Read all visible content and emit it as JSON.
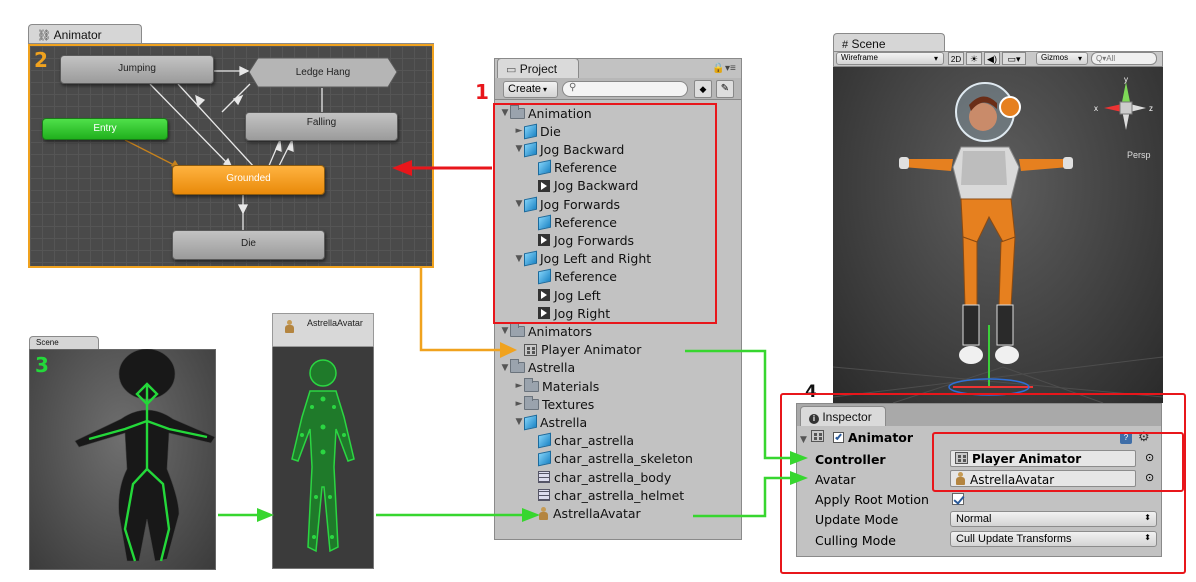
{
  "colors": {
    "highlight_red": "#e8161b",
    "arrow_orange": "#f0a21e",
    "arrow_green": "#37d62f",
    "state_orange": "#f39c1a",
    "entry_green": "#33c92f",
    "skeleton_green": "#24d83a"
  },
  "badges": {
    "b1": "1",
    "b2": "2",
    "b3": "3",
    "b4": "4"
  },
  "animator": {
    "tab_label": "Animator",
    "tab_icon": "animator-icon",
    "states": {
      "jumping": "Jumping",
      "ledge_hang": "Ledge Hang",
      "entry": "Entry",
      "falling": "Falling",
      "grounded": "Grounded",
      "die": "Die"
    }
  },
  "project": {
    "tab_label": "Project",
    "create_label": "Create",
    "search_placeholder": "",
    "tree": [
      {
        "label": "Animation",
        "icon": "folder-icon",
        "depth": 0,
        "arrow": "▼"
      },
      {
        "label": "Die",
        "icon": "model-icon",
        "depth": 1,
        "arrow": "►"
      },
      {
        "label": "Jog Backward",
        "icon": "model-icon",
        "depth": 1,
        "arrow": "▼"
      },
      {
        "label": "Reference",
        "icon": "model-icon",
        "depth": 2,
        "arrow": ""
      },
      {
        "label": "Jog Backward",
        "icon": "clip-icon",
        "depth": 2,
        "arrow": ""
      },
      {
        "label": "Jog Forwards",
        "icon": "model-icon",
        "depth": 1,
        "arrow": "▼"
      },
      {
        "label": "Reference",
        "icon": "model-icon",
        "depth": 2,
        "arrow": ""
      },
      {
        "label": "Jog Forwards",
        "icon": "clip-icon",
        "depth": 2,
        "arrow": ""
      },
      {
        "label": "Jog Left and Right",
        "icon": "model-icon",
        "depth": 1,
        "arrow": "▼"
      },
      {
        "label": "Reference",
        "icon": "model-icon",
        "depth": 2,
        "arrow": ""
      },
      {
        "label": "Jog Left",
        "icon": "clip-icon",
        "depth": 2,
        "arrow": ""
      },
      {
        "label": "Jog Right",
        "icon": "clip-icon",
        "depth": 2,
        "arrow": ""
      },
      {
        "label": "Animators",
        "icon": "folder-icon",
        "depth": 0,
        "arrow": "▼"
      },
      {
        "label": "Player Animator",
        "icon": "controller-icon",
        "depth": 1,
        "arrow": ""
      },
      {
        "label": "Astrella",
        "icon": "folder-icon",
        "depth": 0,
        "arrow": "▼"
      },
      {
        "label": "Materials",
        "icon": "folder-icon",
        "depth": 1,
        "arrow": "►"
      },
      {
        "label": "Textures",
        "icon": "folder-icon",
        "depth": 1,
        "arrow": "►"
      },
      {
        "label": "Astrella",
        "icon": "model-icon",
        "depth": 1,
        "arrow": "▼"
      },
      {
        "label": "char_astrella",
        "icon": "model-icon",
        "depth": 2,
        "arrow": ""
      },
      {
        "label": "char_astrella_skeleton",
        "icon": "model-icon",
        "depth": 2,
        "arrow": ""
      },
      {
        "label": "char_astrella_body",
        "icon": "mesh-icon",
        "depth": 2,
        "arrow": ""
      },
      {
        "label": "char_astrella_helmet",
        "icon": "mesh-icon",
        "depth": 2,
        "arrow": ""
      },
      {
        "label": "AstrellaAvatar",
        "icon": "avatar-icon",
        "depth": 2,
        "arrow": ""
      }
    ]
  },
  "scene3": {
    "tab_label": "Scene"
  },
  "avatar_panel": {
    "title": "AstrellaAvatar"
  },
  "scene_view": {
    "tab_label": "Scene",
    "shading": "Wireframe",
    "mode_2d": "2D",
    "gizmos": "Gizmos",
    "search_placeholder": "Q▾All",
    "persp": "Persp",
    "axes": {
      "y": "y",
      "x": "x",
      "z": "z"
    }
  },
  "inspector": {
    "tab_label": "Inspector",
    "component": "Animator",
    "rows": [
      {
        "label": "Controller",
        "value": "Player Animator"
      },
      {
        "label": "Avatar",
        "value": "AstrellaAvatar"
      },
      {
        "label": "Apply Root Motion",
        "value": ""
      },
      {
        "label": "Update Mode",
        "value": "Normal"
      },
      {
        "label": "Culling Mode",
        "value": "Cull Update Transforms"
      }
    ]
  }
}
